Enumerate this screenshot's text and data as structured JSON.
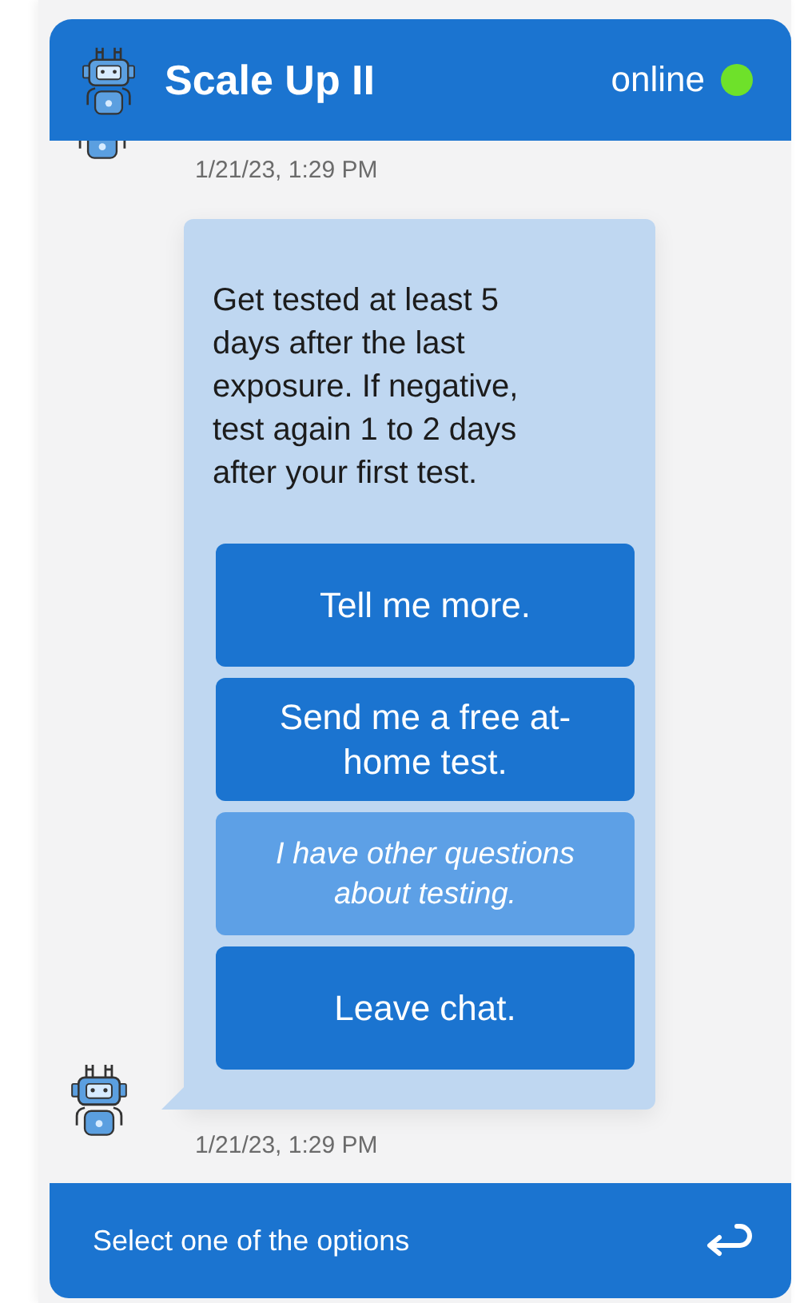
{
  "header": {
    "title": "Scale Up II",
    "status": "online",
    "online": true
  },
  "earlier_message": {
    "timestamp": "1/21/23, 1:29 PM"
  },
  "message": {
    "text": "Get tested at least 5 days after the last exposure. If negative, test again 1 to 2 days after your first test.",
    "timestamp": "1/21/23, 1:29 PM",
    "options": [
      {
        "label": "Tell me more.",
        "highlighted": false
      },
      {
        "label": "Send me a free at-home test.",
        "highlighted": false
      },
      {
        "label": "I have other questions about testing.",
        "highlighted": true
      },
      {
        "label": "Leave chat.",
        "highlighted": false
      }
    ]
  },
  "footer": {
    "placeholder": "Select one of the options"
  }
}
